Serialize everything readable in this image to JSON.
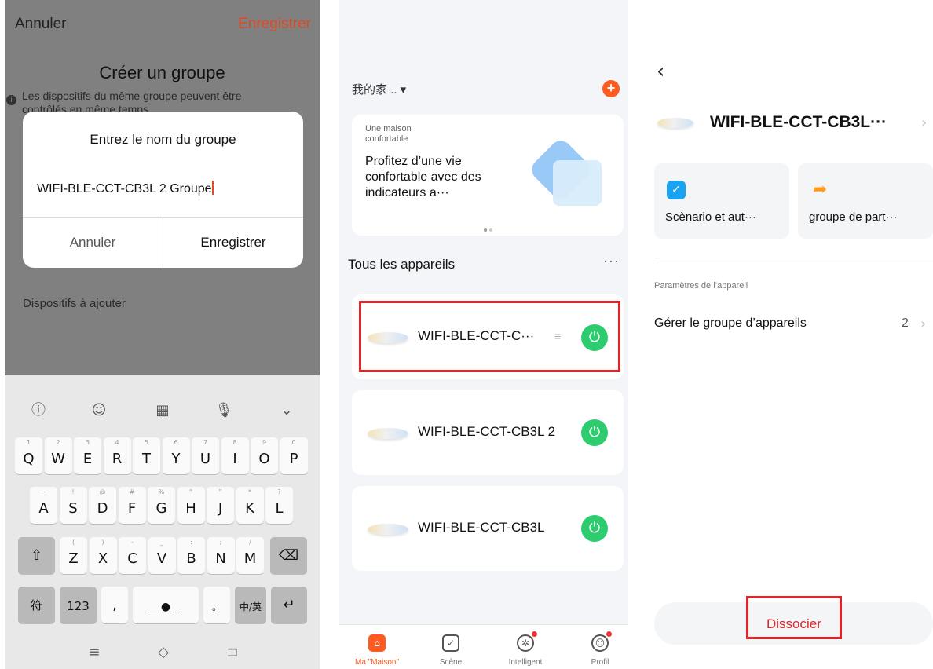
{
  "panel1": {
    "top_left": "Annuler",
    "top_right": "Enregistrer",
    "title": "Créer un groupe",
    "description": "Les dispositifs du même groupe peuvent être contrôlés en même temps",
    "dialog": {
      "title": "Entrez le nom du groupe",
      "input_value": "WIFI-BLE-CCT-CB3L 2 Groupe",
      "cancel": "Annuler",
      "save": "Enregistrer"
    },
    "devices_to_add": "Dispositifs à ajouter",
    "keyboard": {
      "row1": [
        [
          "Q",
          "1"
        ],
        [
          "W",
          "2"
        ],
        [
          "E",
          "3"
        ],
        [
          "R",
          "4"
        ],
        [
          "T",
          "5"
        ],
        [
          "Y",
          "6"
        ],
        [
          "U",
          "7"
        ],
        [
          "I",
          "8"
        ],
        [
          "O",
          "9"
        ],
        [
          "P",
          "0"
        ]
      ],
      "row2": [
        [
          "A",
          "~"
        ],
        [
          "S",
          "!"
        ],
        [
          "D",
          "@"
        ],
        [
          "F",
          "#"
        ],
        [
          "G",
          "%"
        ],
        [
          "H",
          "“"
        ],
        [
          "J",
          "”"
        ],
        [
          "K",
          "*"
        ],
        [
          "L",
          "?"
        ]
      ],
      "row3": [
        [
          "Z",
          "("
        ],
        [
          "X",
          ")"
        ],
        [
          "C",
          "-"
        ],
        [
          "V",
          "_"
        ],
        [
          "B",
          ":"
        ],
        [
          "N",
          ";"
        ],
        [
          "M",
          "/"
        ]
      ],
      "shift": "⇧",
      "backspace": "⌫",
      "sym": "符",
      "num": "123",
      "comma": ",",
      "period": "。",
      "lang": "中/英",
      "enter": "↵",
      "tools": [
        "ⓘ",
        "☺",
        "▦",
        "🎙",
        "⌄"
      ],
      "nav": [
        "≡",
        "◇",
        "⊐"
      ]
    }
  },
  "panel2": {
    "home": "我的家 .. ▾",
    "plus": "+",
    "banner_small": "Une maison confortable",
    "banner_big": "Profitez d’une vie confortable avec des indicateurs a···",
    "section_title": "Tous les appareils",
    "more": "···",
    "devices": [
      {
        "name": "WIFI-BLE-CCT-C···",
        "power": "⏻"
      },
      {
        "name": "WIFI-BLE-CCT-CB3L 2",
        "power": "⏻"
      },
      {
        "name": "WIFI-BLE-CCT-CB3L",
        "power": "⏻"
      }
    ],
    "group_mark": "≡",
    "tabs": [
      {
        "label": "Ma \"Maison\"",
        "icon": "⌂"
      },
      {
        "label": "Scène",
        "icon": "✓"
      },
      {
        "label": "Intelligent",
        "icon": "✲"
      },
      {
        "label": "Profil",
        "icon": "☺"
      }
    ]
  },
  "panel3": {
    "back": "‹",
    "device_name": "WIFI-BLE-CCT-CB3L···",
    "chevron": "›",
    "card_scenario": "Scènario et aut···",
    "card_share": "groupe de part···",
    "section": "Paramètres de l’appareil",
    "manage_group": "Gérer le groupe d’appareils",
    "manage_count": "2",
    "dissociate": "Dissocier"
  },
  "colors": {
    "accent": "#ff5a1f",
    "highlight": "#e0242a",
    "power_green": "#2dcc6f"
  }
}
